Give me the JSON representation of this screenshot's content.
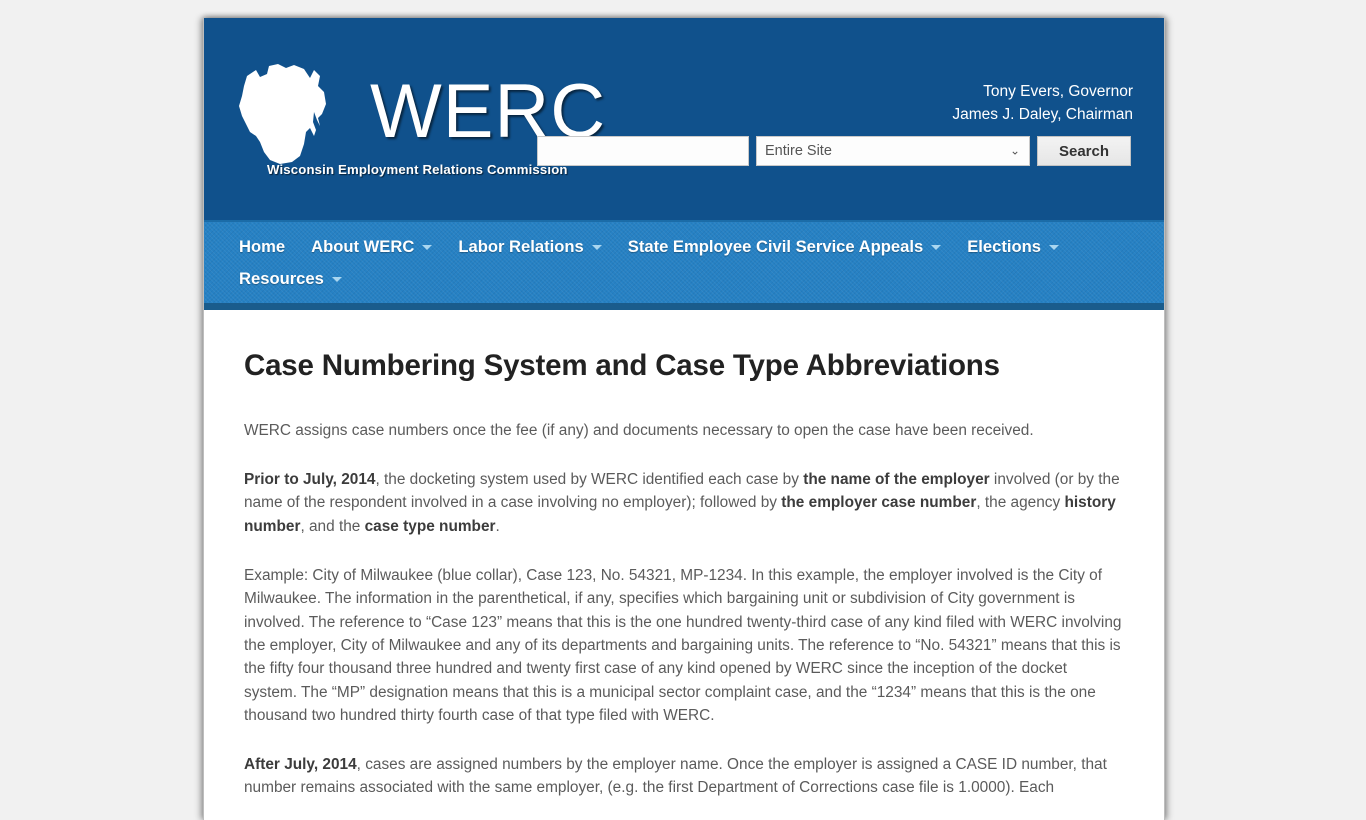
{
  "header": {
    "logo_word": "WERC",
    "logo_subtitle": "Wisconsin Employment Relations Commission",
    "logo_state_icon": "wisconsin-state-outline-icon",
    "officials": [
      "Tony Evers, Governor",
      "James J. Daley, Chairman"
    ]
  },
  "search": {
    "query_value": "",
    "query_placeholder": "",
    "scope_selected": "Entire Site",
    "scope_caret_icon": "chevron-down-icon",
    "submit_label": "Search"
  },
  "nav": {
    "items": [
      {
        "label": "Home",
        "has_dropdown": false
      },
      {
        "label": "About WERC",
        "has_dropdown": true
      },
      {
        "label": "Labor Relations",
        "has_dropdown": true
      },
      {
        "label": "State Employee Civil Service Appeals",
        "has_dropdown": true
      },
      {
        "label": "Elections",
        "has_dropdown": true
      },
      {
        "label": "Resources",
        "has_dropdown": true
      }
    ]
  },
  "main": {
    "title": "Case Numbering System and Case Type Abbreviations",
    "paragraphs": [
      {
        "id": "intro",
        "runs": [
          {
            "text": "WERC assigns case numbers once the fee (if any) and documents necessary to open the case have been received.",
            "bold": false
          }
        ]
      },
      {
        "id": "prior-to-july-2014",
        "runs": [
          {
            "text": "Prior to July, 2014",
            "bold": true
          },
          {
            "text": ", the docketing system used by WERC identified each case by ",
            "bold": false
          },
          {
            "text": "the name of the employer",
            "bold": true
          },
          {
            "text": " involved (or by the name of the respondent involved in a case involving no employer); followed by ",
            "bold": false
          },
          {
            "text": "the employer case number",
            "bold": true
          },
          {
            "text": ", the agency ",
            "bold": false
          },
          {
            "text": "history number",
            "bold": true
          },
          {
            "text": ", and the ",
            "bold": false
          },
          {
            "text": "case type number",
            "bold": true
          },
          {
            "text": ".",
            "bold": false
          }
        ]
      },
      {
        "id": "example",
        "runs": [
          {
            "text": "Example: City of Milwaukee (blue collar), Case 123, No. 54321, MP-1234. In this example, the employer involved is the City of Milwaukee. The information in the parenthetical, if any, specifies which bargaining unit or subdivision of City government is involved. The reference to “Case 123” means that this is the one hundred twenty-third case of any kind filed with WERC involving the employer, City of Milwaukee and any of its departments and bargaining units. The reference to “No. 54321” means that this is the fifty four thousand three hundred and twenty first case of any kind opened by WERC since the inception of the docket system. The “MP” designation means that this is a municipal sector complaint case, and the “1234” means that this is the one thousand two hundred thirty fourth case of that type filed with WERC.",
            "bold": false
          }
        ]
      },
      {
        "id": "after-july-2014",
        "runs": [
          {
            "text": "After July, 2014",
            "bold": true
          },
          {
            "text": ", cases are assigned numbers by the employer name.  Once the employer is assigned a CASE ID number, that number remains associated with the same employer, (e.g. the first Department of Corrections case file is 1.0000).  Each",
            "bold": false
          }
        ]
      }
    ]
  },
  "colors": {
    "header_blue": "#10518c",
    "nav_blue": "#2681c4",
    "nav_bottom_border": "#1a5c8c",
    "page_background": "#f1f1f1",
    "body_text": "#5b5b5b",
    "title_text": "#222222",
    "caret_blue": "#a9d6f0"
  }
}
